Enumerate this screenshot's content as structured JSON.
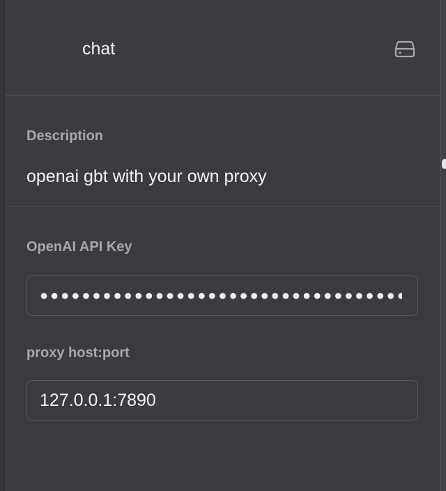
{
  "header": {
    "title": "chat",
    "storage_icon": "storage-drive-icon"
  },
  "description": {
    "label": "Description",
    "text": "openai gbt with your own proxy"
  },
  "api_key": {
    "label": "OpenAI API Key",
    "masked_value": "●●●●●●●●●●●●●●●●●●●●●●●●●●●●●●●●●●●●●●●●"
  },
  "proxy": {
    "label": "proxy host:port",
    "value": "127.0.0.1:7890"
  },
  "colors": {
    "background": "#3c3b3f",
    "label": "#a8a7ab",
    "text": "#f4f4f5",
    "border": "#5b5a5e"
  }
}
